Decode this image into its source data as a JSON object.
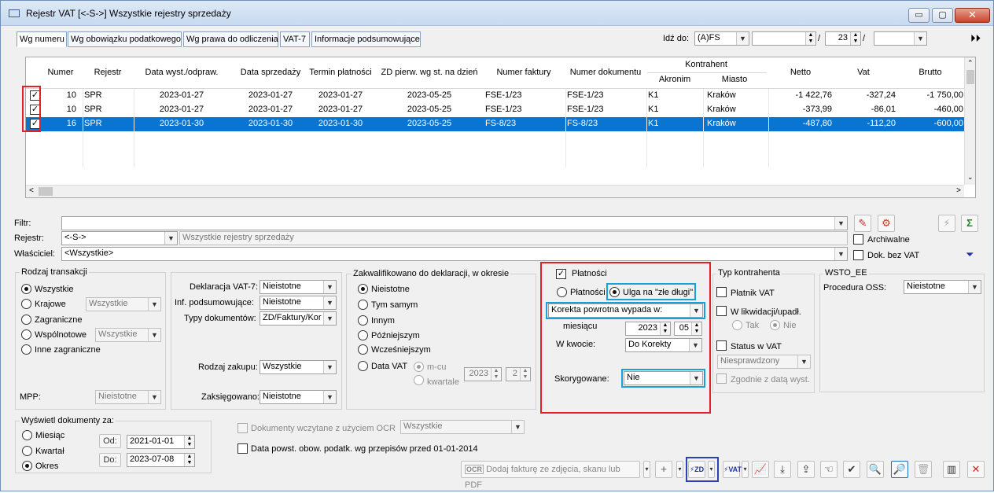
{
  "window": {
    "title": "Rejestr VAT  [<-S->]  Wszystkie rejestry sprzedaży",
    "min": "▭",
    "max": "▢",
    "close": "✕"
  },
  "tabs": [
    "Wg numeru",
    "Wg obowiązku podatkowego",
    "Wg prawa do odliczenia",
    "VAT-7",
    "Informacje podsumowujące"
  ],
  "goto": {
    "label": "Idź do:",
    "value": "(A)FS",
    "number": "",
    "sep1": "/",
    "page": "23",
    "sep2": "/",
    "year": ""
  },
  "grid": {
    "columns": [
      "Numer",
      "Rejestr",
      "Data wyst./odpraw.",
      "Data sprzedaży",
      "Termin płatności",
      "ZD pierw. wg st. na dzień",
      "Numer faktury",
      "Numer dokumentu",
      "Kontrahent",
      "Akronim",
      "Miasto",
      "Netto",
      "Vat",
      "Brutto"
    ],
    "rows": [
      {
        "numer": "10",
        "rejestr": "SPR",
        "data_wyst": "2023-01-27",
        "data_sprz": "2023-01-27",
        "termin": "2023-01-27",
        "zd": "2023-05-25",
        "faktura": "FSE-1/23",
        "dokument": "FSE-1/23",
        "akronim": "K1",
        "miasto": "Kraków",
        "netto": "-1 422,76",
        "vat": "-327,24",
        "brutto": "-1 750,00"
      },
      {
        "numer": "10",
        "rejestr": "SPR",
        "data_wyst": "2023-01-27",
        "data_sprz": "2023-01-27",
        "termin": "2023-01-27",
        "zd": "2023-05-25",
        "faktura": "FSE-1/23",
        "dokument": "FSE-1/23",
        "akronim": "K1",
        "miasto": "Kraków",
        "netto": "-373,99",
        "vat": "-86,01",
        "brutto": "-460,00"
      },
      {
        "numer": "16",
        "rejestr": "SPR",
        "data_wyst": "2023-01-30",
        "data_sprz": "2023-01-30",
        "termin": "2023-01-30",
        "zd": "2023-05-25",
        "faktura": "FS-8/23",
        "dokument": "FS-8/23",
        "akronim": "K1",
        "miasto": "Kraków",
        "netto": "-487,80",
        "vat": "-112,20",
        "brutto": "-600,00"
      }
    ]
  },
  "filter": {
    "filtr_label": "Filtr:",
    "rejestr_label": "Rejestr:",
    "rejestr_value": "<-S->",
    "rejestr_desc": "Wszystkie rejestry sprzedaży",
    "wlasciciel_label": "Właściciel:",
    "wlasciciel_value": "<Wszystkie>",
    "archiwalne": "Archiwalne",
    "dok_bez_vat": "Dok. bez VAT"
  },
  "rodzaj": {
    "title": "Rodzaj transakcji",
    "wszystkie": "Wszystkie",
    "krajowe": "Krajowe",
    "krajowe_combo": "Wszystkie",
    "zagraniczne": "Zagraniczne",
    "wspolnotowe": "Wspólnotowe",
    "wspolnotowe_combo": "Wszystkie",
    "inne": "Inne zagraniczne",
    "mpp": "MPP:",
    "mpp_value": "Nieistotne"
  },
  "deklaracje": {
    "vat7_label": "Deklaracja VAT-7:",
    "vat7_value": "Nieistotne",
    "inf_label": "Inf. podsumowujące:",
    "inf_value": "Nieistotne",
    "typy_label": "Typy dokumentów:",
    "typy_value": "ZD/Faktury/Kor",
    "zakup_label": "Rodzaj zakupu:",
    "zakup_value": "Wszystkie",
    "zaks_label": "Zaksięgowano:",
    "zaks_value": "Nieistotne"
  },
  "zakwalifikowano": {
    "title": "Zakwalifikowano do deklaracji, w okresie",
    "nieistotne": "Nieistotne",
    "tym_samym": "Tym samym",
    "innym": "Innym",
    "pozniejszym": "Późniejszym",
    "wczesniejszym": "Wcześniejszym",
    "data_vat": "Data VAT",
    "mcu": "m-cu",
    "kwartale": "kwartale",
    "rok": "2023",
    "okres": "2"
  },
  "platnosci": {
    "check_label": "Płatności",
    "radio_platnosci": "Płatności",
    "radio_ulga": "Ulga na \"złe długi\"",
    "korekta_value": "Korekta powrotna wypada w:",
    "miesiacu": "miesiącu",
    "rok": "2023",
    "mies": "05",
    "w_kwocie_label": "W kwocie:",
    "w_kwocie_value": "Do Korekty",
    "skorygowane_label": "Skorygowane:",
    "skorygowane_value": "Nie"
  },
  "typ_kontrahenta": {
    "title": "Typ kontrahenta",
    "platnik": "Płatnik VAT",
    "likwidacji": "W likwidacji/upadł.",
    "tak": "Tak",
    "nie": "Nie",
    "status": "Status w VAT",
    "status_value": "Niesprawdzony",
    "zgodnie": "Zgodnie z datą wyst."
  },
  "wsto": {
    "title": "WSTO_EE",
    "procedura_label": "Procedura OSS:",
    "procedura_value": "Nieistotne"
  },
  "wyswietl": {
    "title": "Wyświetl dokumenty za:",
    "miesiac": "Miesiąc",
    "kwartal": "Kwartał",
    "okres": "Okres",
    "od_label": "Od:",
    "od_value": "2021-01-01",
    "do_label": "Do:",
    "do_value": "2023-07-08"
  },
  "bottom": {
    "ocr_label": "Dokumenty wczytane z użyciem OCR",
    "ocr_value": "Wszystkie",
    "data_powst": "Data powst. obow. podatk. wg przepisów przed 01-01-2014",
    "dodaj_btn": "Dodaj fakturę ze zdjęcia, skanu lub PDF"
  }
}
